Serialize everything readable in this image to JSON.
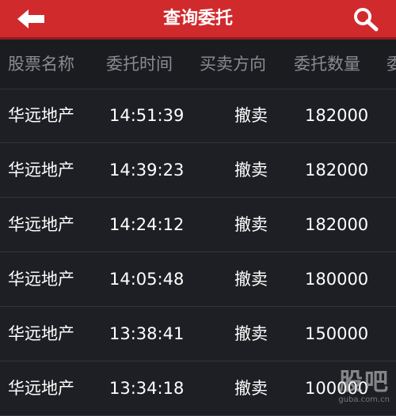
{
  "header": {
    "title": "查询委托",
    "bg_color": "#d02a2d",
    "back_icon": "arrow-left-icon",
    "search_icon": "search-icon"
  },
  "columns": [
    "股票名称",
    "委托时间",
    "买卖方向",
    "委托数量",
    "委"
  ],
  "rows": [
    {
      "name": "华远地产",
      "time": "14:51:39",
      "direction": "撤卖",
      "quantity": "182000"
    },
    {
      "name": "华远地产",
      "time": "14:39:23",
      "direction": "撤卖",
      "quantity": "182000"
    },
    {
      "name": "华远地产",
      "time": "14:24:12",
      "direction": "撤卖",
      "quantity": "182000"
    },
    {
      "name": "华远地产",
      "time": "14:05:48",
      "direction": "撤卖",
      "quantity": "180000"
    },
    {
      "name": "华远地产",
      "time": "13:38:41",
      "direction": "撤卖",
      "quantity": "150000"
    },
    {
      "name": "华远地产",
      "time": "13:34:18",
      "direction": "撤卖",
      "quantity": "100000"
    }
  ],
  "watermark": {
    "logo": "股吧",
    "url": "guba.com.cn"
  }
}
